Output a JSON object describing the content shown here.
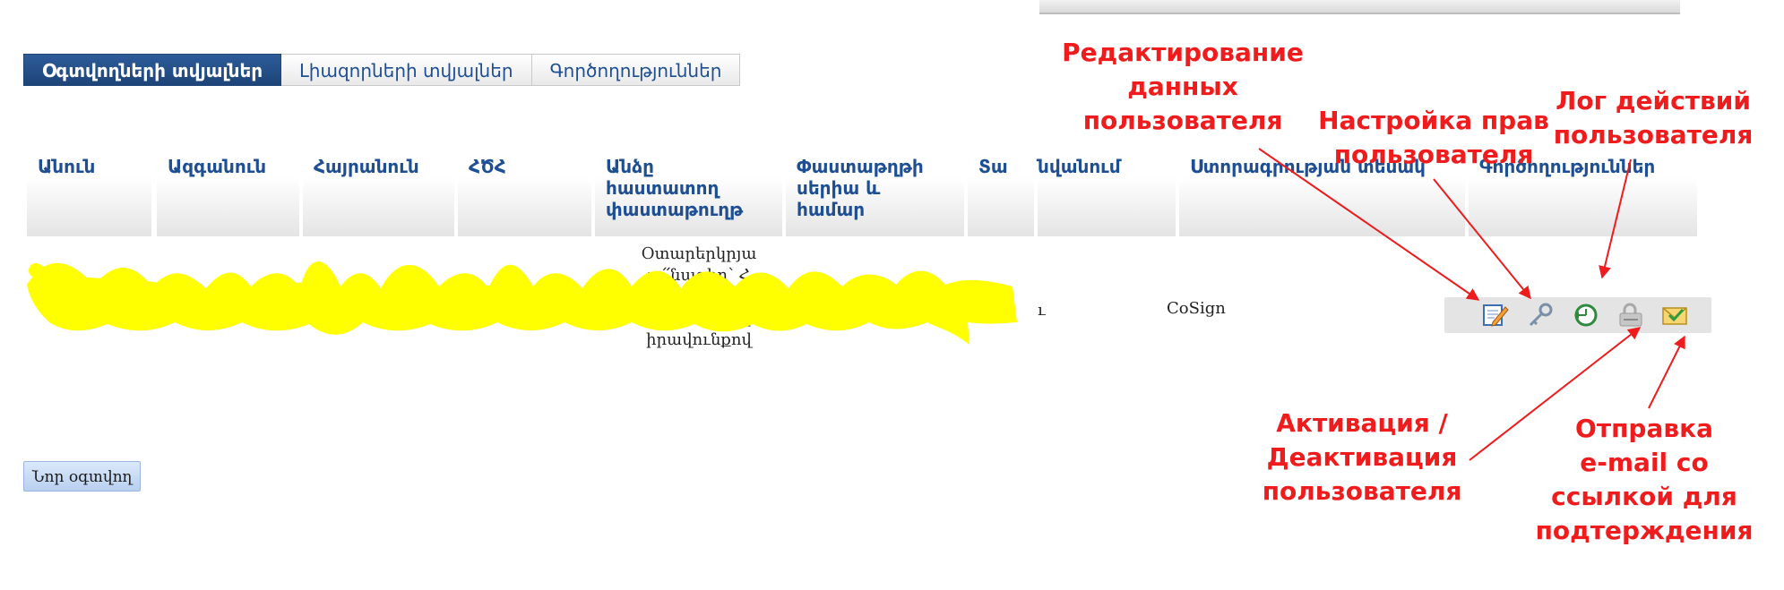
{
  "tabs": [
    {
      "label": "Օգտվողների տվյալներ",
      "active": true
    },
    {
      "label": "Լիազորների տվյալներ",
      "active": false
    },
    {
      "label": "Գործողություններ",
      "active": false
    }
  ],
  "table": {
    "headers": [
      "Անուն",
      "Ազգանուն",
      "Հայրանուն",
      "ՀԾՀ",
      "Անձը\nհաստատող\nփաստաթուղթ",
      "Փաստաթղթի\nսերիա և\nհամար",
      "Տա",
      "նվանում",
      "Ստորագրության տեսակ",
      "Գործողություններ"
    ],
    "row": {
      "document_text": "Օտարերկրյա\nա՛՛նագիր՝ Հ\n\nաշխատանքի\nիրավունքով",
      "org_fragment": "ւ",
      "signature_type": "CoSign"
    }
  },
  "actions": [
    {
      "icon": "edit-icon",
      "title": "Редактирование данных пользователя"
    },
    {
      "icon": "key-icon",
      "title": "Настройка прав пользователя"
    },
    {
      "icon": "log-clock-icon",
      "title": "Лог действий пользователя"
    },
    {
      "icon": "activate-lock-icon",
      "title": "Активация / Деактивация пользователя"
    },
    {
      "icon": "send-email-icon",
      "title": "Отправка e-mail со ссылкой для подтерждения"
    }
  ],
  "new_user_button": "Նոր օգտվող",
  "annotations": {
    "edit": "Редактирование\nданных\nпользователя",
    "rights": "Настройка прав\nпользователя",
    "log": "Лог действий\nпользователя",
    "activate": "Активация /\nДеактивация\nпользователя",
    "email": "Отправка\ne-mail со\nссылкой для\nподтерждения"
  },
  "colors": {
    "tab_active": "#1e4478",
    "header_text": "#1f4f93",
    "annotation": "#ee1c1c",
    "redaction": "#ffff00"
  }
}
